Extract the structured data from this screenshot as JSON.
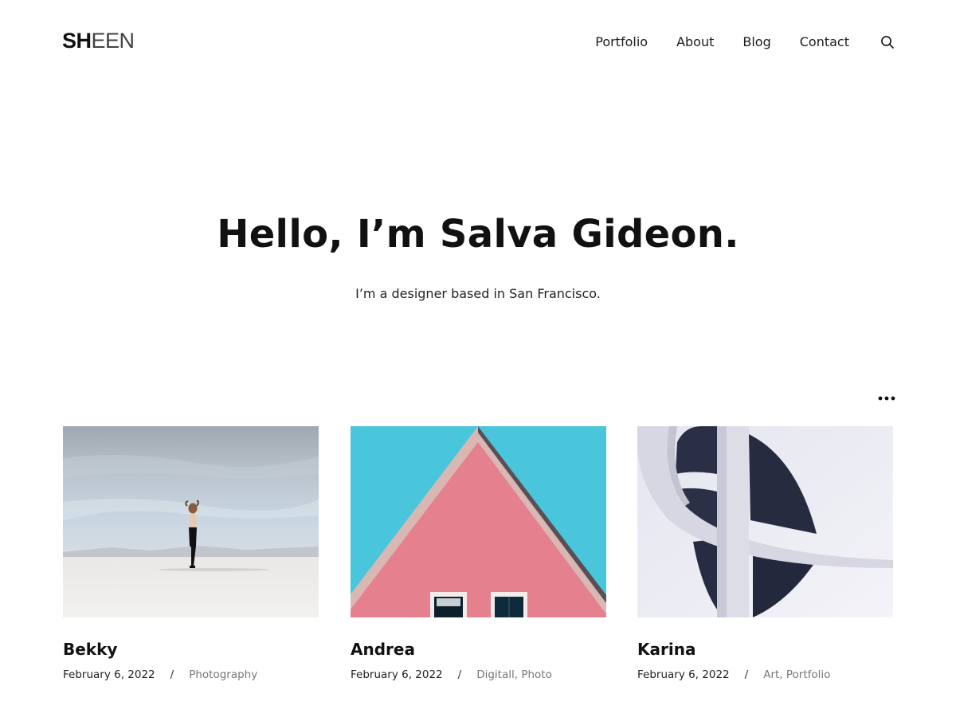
{
  "site": {
    "logo_bold": "SH",
    "logo_light": "EEN"
  },
  "nav": {
    "items": [
      {
        "label": "Portfolio"
      },
      {
        "label": "About"
      },
      {
        "label": "Blog"
      },
      {
        "label": "Contact"
      }
    ],
    "search_icon": "search-icon"
  },
  "hero": {
    "title": "Hello, I’m Salva Gideon.",
    "subtitle": "I’m a designer based in San Francisco."
  },
  "more_icon": "more-dots-icon",
  "posts": [
    {
      "title": "Bekky",
      "date": "February 6, 2022",
      "separator": "/",
      "categories": "Photography"
    },
    {
      "title": "Andrea",
      "date": "February 6, 2022",
      "separator": "/",
      "categories": "Digitall, Photo"
    },
    {
      "title": "Karina",
      "date": "February 6, 2022",
      "separator": "/",
      "categories": "Art, Portfolio"
    }
  ],
  "colors": {
    "background": "#ffffff",
    "text": "#111111",
    "muted": "#777777",
    "andrea_sky": "#49c6dc",
    "andrea_wall": "#e5808f"
  }
}
